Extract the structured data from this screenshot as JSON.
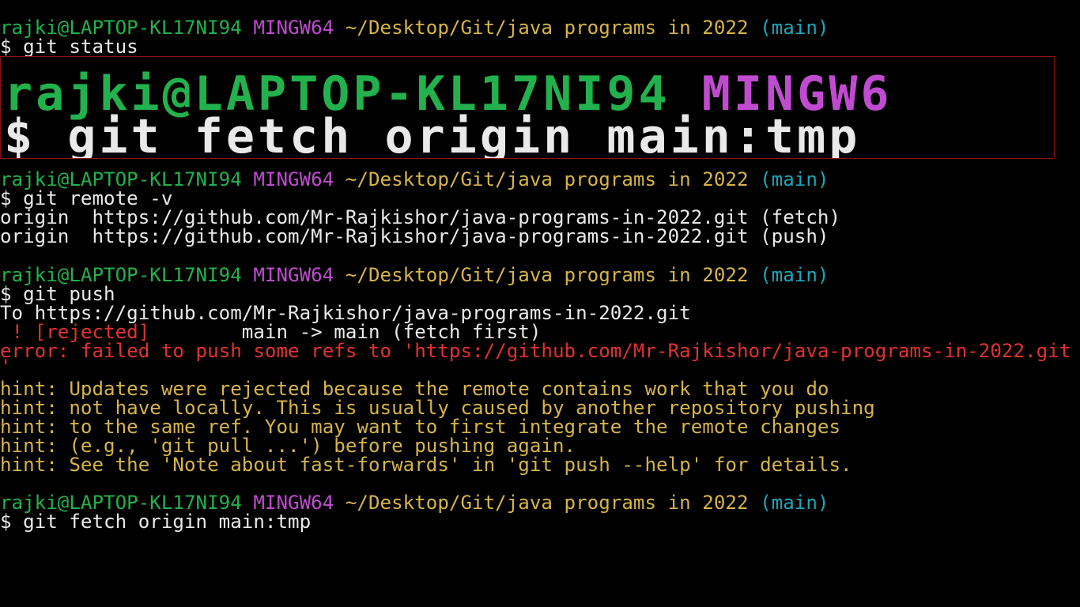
{
  "prompt": {
    "user_host": "rajki@LAPTOP-KL17NI94",
    "shell": "MINGW64",
    "path": "~/Desktop/Git/java programs in 2022",
    "branch": "(main)"
  },
  "zoom": {
    "user_host": "rajki@LAPTOP-KL17NI94",
    "shell": "MINGW6",
    "command": "$ git fetch origin main:tmp"
  },
  "commands": {
    "status": "$ git status",
    "remote": "$ git remote -v",
    "push": "$ git push",
    "fetch": "$ git fetch origin main:tmp"
  },
  "remote_output": [
    "origin  https://github.com/Mr-Rajkishor/java-programs-in-2022.git (fetch)",
    "origin  https://github.com/Mr-Rajkishor/java-programs-in-2022.git (push)"
  ],
  "push_output": {
    "to_line": "To https://github.com/Mr-Rajkishor/java-programs-in-2022.git",
    "rejected_tag": " ! [rejected]",
    "rejected_detail": "        main -> main (fetch first)",
    "error_line": "error: failed to push some refs to 'https://github.com/Mr-Rajkishor/java-programs-in-2022.git",
    "error_cont": "'",
    "hints": [
      "hint: Updates were rejected because the remote contains work that you do",
      "hint: not have locally. This is usually caused by another repository pushing",
      "hint: to the same ref. You may want to first integrate the remote changes",
      "hint: (e.g., 'git pull ...') before pushing again.",
      "hint: See the 'Note about fast-forwards' in 'git push --help' for details."
    ]
  },
  "colors": {
    "background": "#000000",
    "user_host": "#22b14c",
    "shell": "#c04bd0",
    "path": "#d6b44a",
    "branch": "#1aa7b8",
    "error": "#e0322f",
    "zoom_border": "#8a1414"
  }
}
